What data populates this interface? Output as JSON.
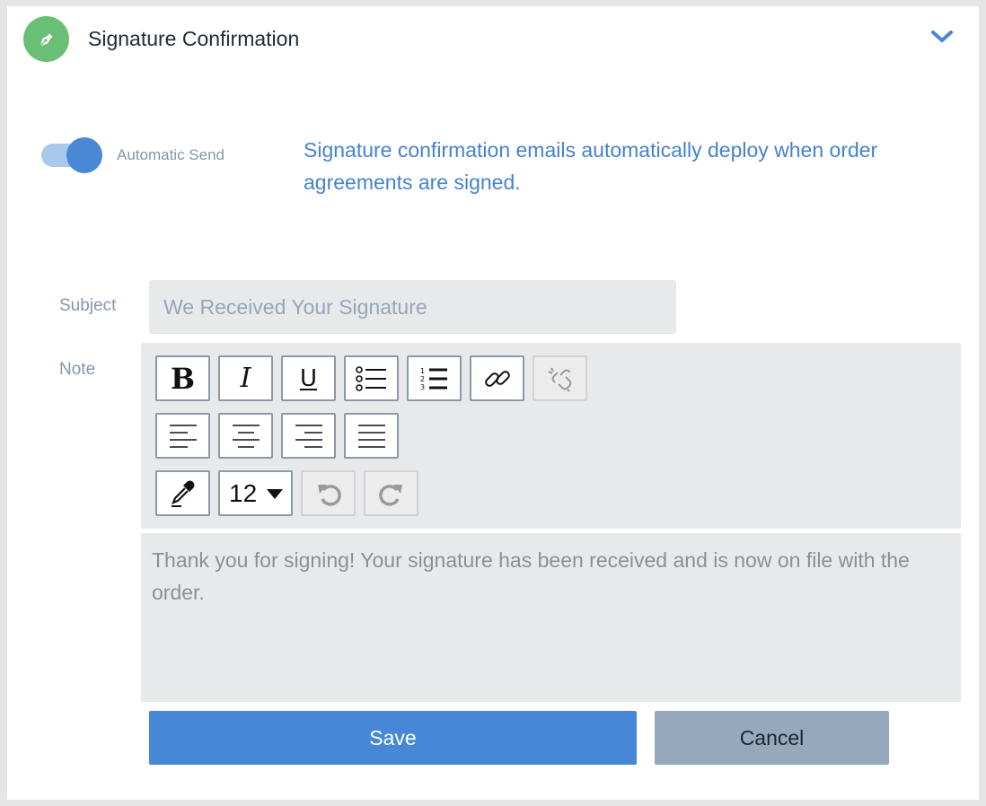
{
  "header": {
    "title": "Signature Confirmation",
    "icon": "pen-nib-icon",
    "icon_bg": "#69bf76"
  },
  "settings": {
    "auto_send_label": "Automatic Send",
    "auto_send_enabled": true,
    "info_text": "Signature confirmation emails automatically deploy when order agreements are signed."
  },
  "form": {
    "subject_label": "Subject",
    "subject_placeholder": "We Received Your Signature",
    "subject_value": "",
    "note_label": "Note",
    "note_value": "Thank you for signing! Your signature has been received and is now on file with the order.",
    "font_size": "12"
  },
  "toolbar": {
    "bold_glyph": "B",
    "italic_glyph": "I",
    "underline_glyph": "U"
  },
  "actions": {
    "save_label": "Save",
    "cancel_label": "Cancel"
  },
  "colors": {
    "accent": "#4687d6",
    "info_text": "#4582cf",
    "cancel_bg": "#96a8bc"
  }
}
